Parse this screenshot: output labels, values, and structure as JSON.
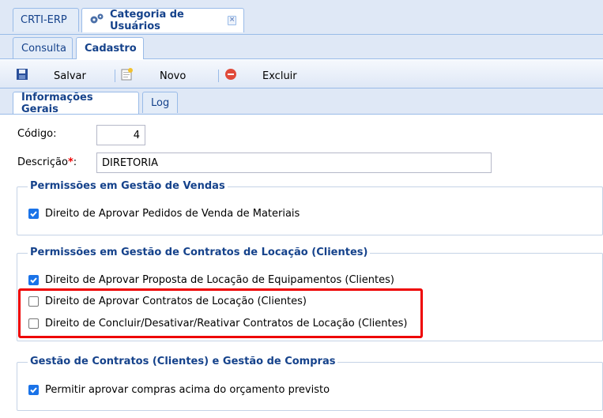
{
  "top_tabs": [
    {
      "label": "CRTI-ERP"
    },
    {
      "label": "Categoria de Usuários",
      "close": "×"
    }
  ],
  "sub_tabs": [
    {
      "label": "Consulta"
    },
    {
      "label": "Cadastro"
    }
  ],
  "toolbar": {
    "save_label": "Salvar",
    "new_label": "Novo",
    "delete_label": "Excluir"
  },
  "form_tabs": [
    {
      "label": "Informações Gerais"
    },
    {
      "label": "Log"
    }
  ],
  "form": {
    "codigo_label": "Código:",
    "codigo_value": "4",
    "descricao_label": "Descrição",
    "required_mark": "*",
    "descricao_suffix": ":",
    "descricao_value": "DIRETORIA"
  },
  "groups": [
    {
      "title": "Permissões em Gestão de Vendas",
      "items": [
        {
          "label": "Direito de Aprovar Pedidos de Venda de Materiais",
          "checked": true
        }
      ]
    },
    {
      "title": "Permissões em Gestão de Contratos de Locação (Clientes)",
      "items": [
        {
          "label": "Direito de Aprovar Proposta de Locação de Equipamentos (Clientes)",
          "checked": true
        },
        {
          "label": "Direito de Aprovar Contratos de Locação (Clientes)",
          "checked": false
        },
        {
          "label": "Direito de Concluir/Desativar/Reativar Contratos de Locação (Clientes)",
          "checked": false
        }
      ]
    },
    {
      "title": "Gestão de Contratos (Clientes) e Gestão de Compras",
      "items": [
        {
          "label": "Permitir aprovar compras acima do orçamento previsto",
          "checked": true
        }
      ]
    }
  ],
  "colors": {
    "accent": "#15428b",
    "checkbox": "#1a73e8",
    "highlight": "#ee0000",
    "strip": "#dfe8f6"
  },
  "icons": [
    "gear-icon",
    "close-icon",
    "save-icon",
    "new-document-icon",
    "delete-icon",
    "checkbox-checked-icon"
  ]
}
